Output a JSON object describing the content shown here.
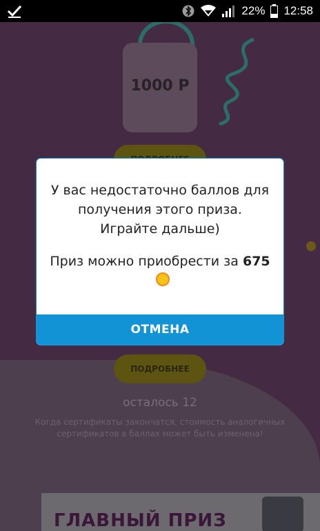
{
  "status_bar": {
    "battery_percent": "22%",
    "time": "12:58",
    "icons": [
      "checkmark-icon",
      "bluetooth-icon",
      "wifi-icon",
      "signal-icon",
      "battery-icon"
    ]
  },
  "background": {
    "gift_price": "1000 Р",
    "details_button_top": "ПОДРОБНЕЕ",
    "details_button_bottom": "ПОДРОБНЕЕ",
    "remaining": "осталось 12",
    "note": "Когда сертификаты закончатся, стоимость аналогичных сертификатов в баллах может быть изменена!",
    "grand_prize": "ГЛАВНЫЙ ПРИЗ"
  },
  "dialog": {
    "message": "У вас недостаточно баллов для получения этого приза. Играйте дальше)",
    "price_prefix": "Приз можно приобрести за ",
    "price_value": "675",
    "cancel_label": "ОТМЕНА"
  },
  "colors": {
    "accent": "#1193d6",
    "coin": "#f7c31a"
  }
}
